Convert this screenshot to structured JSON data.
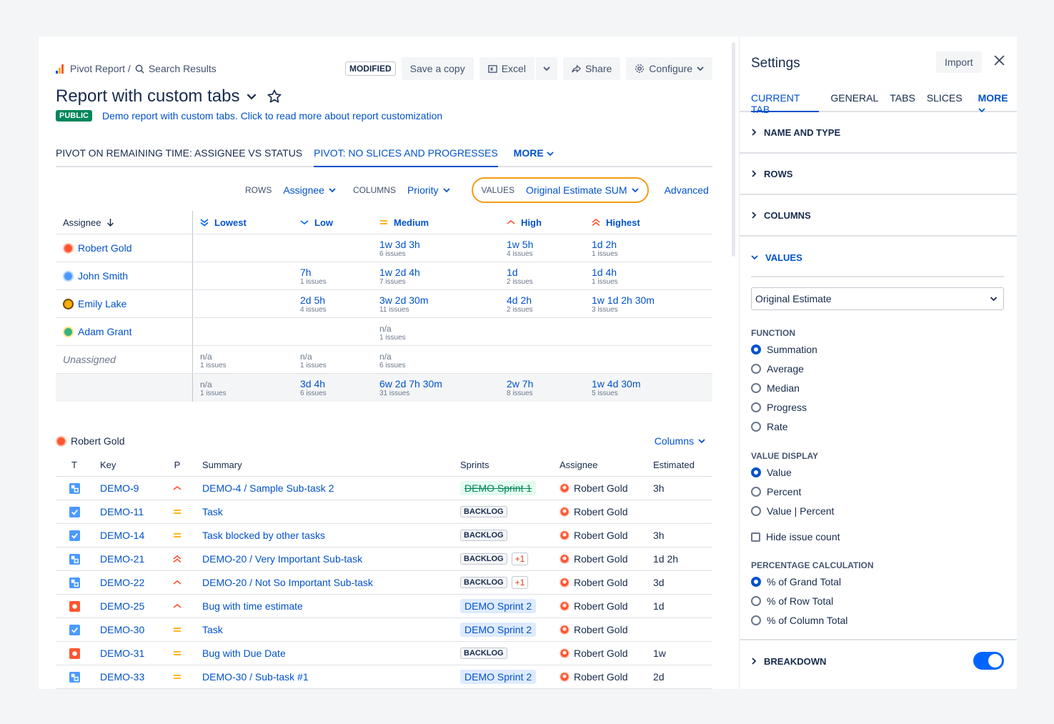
{
  "breadcrumb": {
    "parent": "Pivot Report /",
    "current": "Search Results"
  },
  "toolbar": {
    "modified": "MODIFIED",
    "save_copy": "Save a copy",
    "excel": "Excel",
    "share": "Share",
    "configure": "Configure"
  },
  "report": {
    "title": "Report with custom tabs",
    "badge": "PUBLIC",
    "description": "Demo report with custom tabs. Click to read more about report customization"
  },
  "tabs": [
    {
      "label": "PIVOT ON REMAINING TIME: ASSIGNEE VS STATUS"
    },
    {
      "label": "PIVOT: NO SLICES AND PROGRESSES"
    },
    {
      "label": "MORE"
    }
  ],
  "config": {
    "rows_label": "ROWS",
    "rows_value": "Assignee",
    "columns_label": "COLUMNS",
    "columns_value": "Priority",
    "values_label": "VALUES",
    "values_value": "Original Estimate SUM",
    "advanced": "Advanced"
  },
  "pivot": {
    "header": {
      "assignee": "Assignee",
      "lowest": "Lowest",
      "low": "Low",
      "medium": "Medium",
      "high": "High",
      "highest": "Highest"
    },
    "rows": [
      {
        "name": "Robert Gold",
        "cells": [
          null,
          null,
          {
            "v": "1w 3d 3h",
            "c": "6 issues"
          },
          {
            "v": "1w 5h",
            "c": "4 issues"
          },
          {
            "v": "1d 2h",
            "c": "1 issues"
          }
        ]
      },
      {
        "name": "John Smith",
        "cells": [
          null,
          {
            "v": "7h",
            "c": "1 issues"
          },
          {
            "v": "1w 2d 4h",
            "c": "7 issues"
          },
          {
            "v": "1d",
            "c": "2 issues"
          },
          {
            "v": "1d 4h",
            "c": "1 issues"
          }
        ]
      },
      {
        "name": "Emily Lake",
        "cells": [
          null,
          {
            "v": "2d 5h",
            "c": "4 issues"
          },
          {
            "v": "3w 2d 30m",
            "c": "11 issues"
          },
          {
            "v": "4d 2h",
            "c": "2 issues"
          },
          {
            "v": "1w 1d 2h 30m",
            "c": "3 issues"
          }
        ]
      },
      {
        "name": "Adam Grant",
        "cells": [
          null,
          null,
          {
            "na": "n/a",
            "c": "1 issues"
          },
          null,
          null
        ]
      },
      {
        "name": "Unassigned",
        "cells": [
          {
            "na": "n/a",
            "c": "1 issues"
          },
          {
            "na": "n/a",
            "c": "1 issues"
          },
          {
            "na": "n/a",
            "c": "6 issues"
          },
          null,
          null
        ]
      }
    ],
    "total": [
      {
        "na": "n/a",
        "c": "1 issues"
      },
      {
        "v": "3d 4h",
        "c": "6 issues"
      },
      {
        "v": "6w 2d 7h 30m",
        "c": "31 issues"
      },
      {
        "v": "2w 7h",
        "c": "8 issues"
      },
      {
        "v": "1w 4d 30m",
        "c": "5 issues"
      }
    ]
  },
  "issues": {
    "assignee": "Robert Gold",
    "columns_btn": "Columns",
    "headers": {
      "t": "T",
      "key": "Key",
      "p": "P",
      "summary": "Summary",
      "sprints": "Sprints",
      "assignee": "Assignee",
      "estimated": "Estimated"
    },
    "rows": [
      {
        "type": "subtask",
        "key": "DEMO-9",
        "priority": "high",
        "summary": "DEMO-4 /  Sample Sub-task 2",
        "sprint": "DEMO Sprint 1",
        "sprint_style": "done",
        "plus": "",
        "assignee": "Robert Gold",
        "estimated": "3h"
      },
      {
        "type": "task",
        "key": "DEMO-11",
        "priority": "medium",
        "summary": "Task",
        "sprint": "BACKLOG",
        "sprint_style": "backlog",
        "plus": "",
        "assignee": "Robert Gold",
        "estimated": ""
      },
      {
        "type": "task",
        "key": "DEMO-14",
        "priority": "medium",
        "summary": "Task blocked by other tasks",
        "sprint": "BACKLOG",
        "sprint_style": "backlog",
        "plus": "",
        "assignee": "Robert Gold",
        "estimated": "3h"
      },
      {
        "type": "subtask",
        "key": "DEMO-21",
        "priority": "highest",
        "summary": "DEMO-20 /  Very Important Sub-task",
        "sprint": "BACKLOG",
        "sprint_style": "backlog",
        "plus": "+1",
        "assignee": "Robert Gold",
        "estimated": "1d 2h"
      },
      {
        "type": "subtask",
        "key": "DEMO-22",
        "priority": "high",
        "summary": "DEMO-20 /  Not So Important Sub-task",
        "sprint": "BACKLOG",
        "sprint_style": "backlog",
        "plus": "+1",
        "assignee": "Robert Gold",
        "estimated": "3d"
      },
      {
        "type": "bug",
        "key": "DEMO-25",
        "priority": "high",
        "summary": "Bug with time estimate",
        "sprint": "DEMO Sprint 2",
        "sprint_style": "sprint",
        "plus": "",
        "assignee": "Robert Gold",
        "estimated": "1d"
      },
      {
        "type": "task",
        "key": "DEMO-30",
        "priority": "medium",
        "summary": "Task",
        "sprint": "DEMO Sprint 2",
        "sprint_style": "sprint",
        "plus": "",
        "assignee": "Robert Gold",
        "estimated": ""
      },
      {
        "type": "bug",
        "key": "DEMO-31",
        "priority": "medium",
        "summary": "Bug with Due Date",
        "sprint": "BACKLOG",
        "sprint_style": "backlog",
        "plus": "",
        "assignee": "Robert Gold",
        "estimated": "1w"
      },
      {
        "type": "subtask",
        "key": "DEMO-33",
        "priority": "medium",
        "summary": "DEMO-30 /  Sub-task #1",
        "sprint": "DEMO Sprint 2",
        "sprint_style": "sprint",
        "plus": "",
        "assignee": "Robert Gold",
        "estimated": "2d"
      }
    ]
  },
  "settings": {
    "title": "Settings",
    "import": "Import",
    "tabs": [
      "CURRENT TAB",
      "GENERAL",
      "TABS",
      "SLICES",
      "MORE"
    ],
    "sections": {
      "name_type": "NAME AND TYPE",
      "rows": "ROWS",
      "columns": "COLUMNS",
      "values": "VALUES",
      "breakdown": "BREAKDOWN"
    },
    "field_select": "Original Estimate",
    "function_label": "FUNCTION",
    "functions": [
      "Summation",
      "Average",
      "Median",
      "Progress",
      "Rate"
    ],
    "function_selected": "Summation",
    "value_display_label": "VALUE DISPLAY",
    "value_display": [
      "Value",
      "Percent",
      "Value | Percent"
    ],
    "value_display_selected": "Value",
    "hide_issue_count": "Hide issue count",
    "percentage_label": "PERCENTAGE CALCULATION",
    "percentage": [
      "% of Grand Total",
      "% of Row Total",
      "% of Column Total"
    ],
    "percentage_selected": "% of Grand Total",
    "breakdown_enabled": true
  },
  "colors": {
    "accent": "#0052cc",
    "values_highlight": "#f39c12",
    "public": "#00875a"
  }
}
